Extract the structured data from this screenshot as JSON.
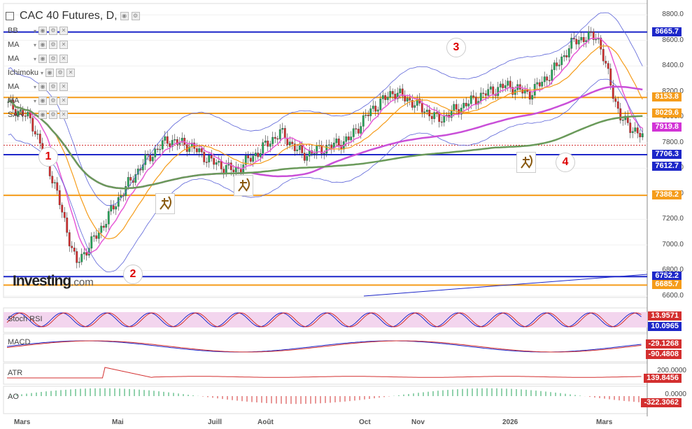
{
  "header": {
    "title": "CAC 40 Futures, D,"
  },
  "indicators": [
    {
      "label": "BB"
    },
    {
      "label": "MA"
    },
    {
      "label": "MA"
    },
    {
      "label": "Ichimoku"
    },
    {
      "label": "MA"
    },
    {
      "label": "MA"
    },
    {
      "label": "SAR"
    }
  ],
  "price_axis": {
    "ticks": [
      "8800.0",
      "8600.0",
      "8400.0",
      "8200.0",
      "8000.0",
      "7800.0",
      "7600.0",
      "7400.0",
      "7200.0",
      "7000.0",
      "6800.0",
      "6600.0"
    ]
  },
  "price_tags": [
    {
      "text": "8665.7",
      "bg": "#1d27c9"
    },
    {
      "text": "8153.8",
      "bg": "#f59c1a"
    },
    {
      "text": "8029.6",
      "bg": "#f59c1a"
    },
    {
      "text": "7919.8",
      "bg": "#d233d6"
    },
    {
      "text": "7706.3",
      "bg": "#1d27c9"
    },
    {
      "text": "7612.7",
      "bg": "#1d27c9"
    },
    {
      "text": "7388.2",
      "bg": "#f59c1a"
    },
    {
      "text": "6752.2",
      "bg": "#1d27c9"
    },
    {
      "text": "6685.7",
      "bg": "#f59c1a"
    }
  ],
  "annotations": [
    {
      "text": "1"
    },
    {
      "text": "2"
    },
    {
      "text": "3"
    },
    {
      "text": "4"
    }
  ],
  "branding": {
    "name": "Investing",
    "suffix": ".com"
  },
  "panes": {
    "stoch": {
      "label": "Stoch RSI",
      "v1": "13.9571",
      "v2": "10.0965"
    },
    "macd": {
      "label": "MACD",
      "v1": "-29.1268",
      "v2": "-90.4808"
    },
    "atr": {
      "label": "ATR",
      "axis": "200.0000",
      "v1": "139.8456"
    },
    "ao": {
      "label": "AO",
      "axis": "0.0000",
      "v1": "-322.3062"
    }
  },
  "x_axis": [
    "Mars",
    "Mai",
    "Juill",
    "Août",
    "Oct",
    "Nov",
    "2026",
    "Mars"
  ],
  "colors": {
    "candle_up": "#26a65b",
    "candle_down": "#d32f2f",
    "support": "#1d27c9",
    "orange": "#f59c1a",
    "magenta": "#d233d6"
  },
  "chart_data": {
    "type": "candlestick",
    "title": "CAC 40 Futures, D,",
    "ylim": [
      6600,
      8900
    ],
    "horizontal_levels": [
      8665.7,
      8153.8,
      8029.6,
      7919.8,
      7706.3,
      7612.7,
      7388.2,
      6752.2,
      6685.7
    ],
    "close_path": [
      [
        "Mars",
        8100
      ],
      [
        "Mars",
        7980
      ],
      [
        "Avr",
        7500
      ],
      [
        "Avr",
        6850
      ],
      [
        "Avr",
        7100
      ],
      [
        "Mai",
        7400
      ],
      [
        "Mai",
        7650
      ],
      [
        "Mai",
        7820
      ],
      [
        "Juin",
        7780
      ],
      [
        "Juin",
        7650
      ],
      [
        "Juill",
        7580
      ],
      [
        "Juill",
        7720
      ],
      [
        "Août",
        7880
      ],
      [
        "Août",
        7700
      ],
      [
        "Sept",
        7760
      ],
      [
        "Sept",
        7820
      ],
      [
        "Oct",
        8050
      ],
      [
        "Oct",
        8200
      ],
      [
        "Nov",
        8100
      ],
      [
        "Nov",
        7980
      ],
      [
        "Déc",
        8080
      ],
      [
        "Déc",
        8180
      ],
      [
        "2026",
        8250
      ],
      [
        "Janv",
        8180
      ],
      [
        "Févr",
        8350
      ],
      [
        "Févr",
        8600
      ],
      [
        "Mars",
        8640
      ],
      [
        "Mars",
        8000
      ],
      [
        "Mars",
        7840
      ]
    ]
  }
}
